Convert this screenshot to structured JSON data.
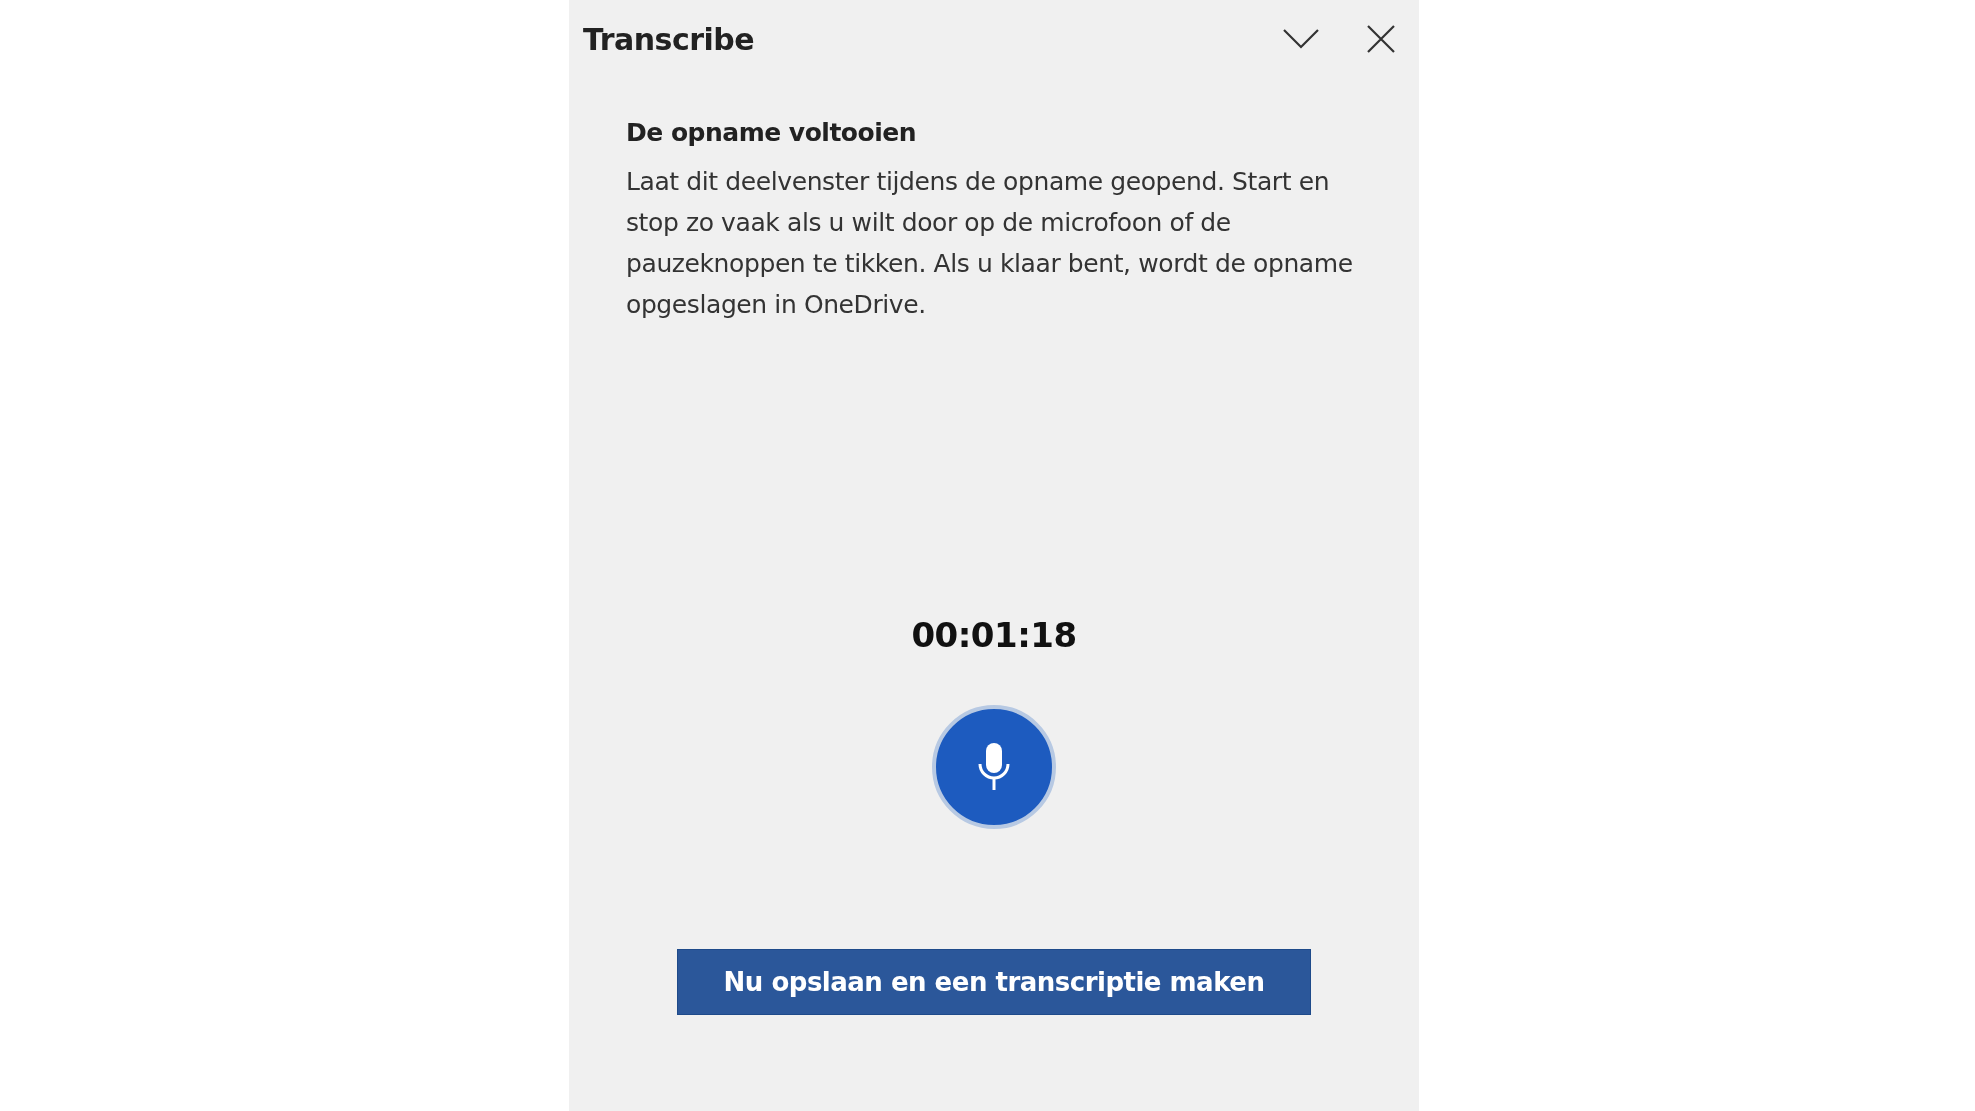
{
  "pane": {
    "title": "Transcribe"
  },
  "section": {
    "heading": "De opname voltooien",
    "description": "Laat dit deelvenster tijdens de opname geopend. Start en stop zo vaak als u wilt door op de microfoon of de pauzeknoppen te tikken. Als u klaar bent, wordt de opname opgeslagen in OneDrive."
  },
  "timer": "00:01:18",
  "save_button": "Nu opslaan en een transcriptie maken"
}
